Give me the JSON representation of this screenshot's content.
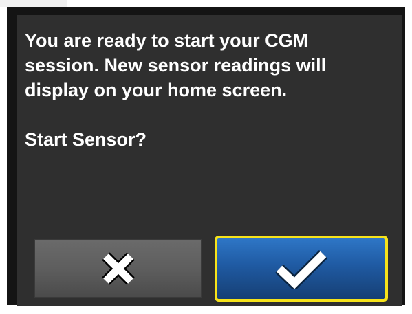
{
  "dialog": {
    "message": "You are ready to start your CGM session. New sensor readings will display on your home screen.",
    "question": "Start Sensor?"
  },
  "buttons": {
    "cancel": {
      "icon": "x-icon"
    },
    "confirm": {
      "icon": "checkmark-icon",
      "highlight_color": "#f7e31a"
    }
  },
  "colors": {
    "screen_background": "#2f2f2f",
    "text": "#ffffff",
    "confirm_blue": "#1f5aa2",
    "cancel_gray": "#5e5e5e"
  }
}
